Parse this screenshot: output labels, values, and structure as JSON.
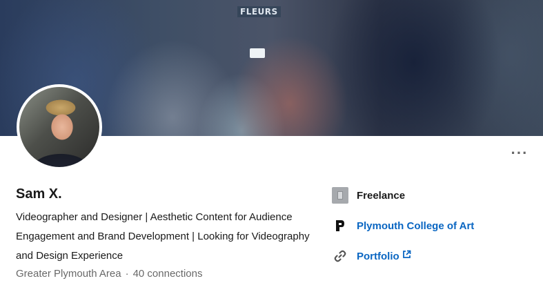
{
  "cover": {
    "sign_text": "FLEURS"
  },
  "profile": {
    "name": "Sam X.",
    "headline": "Videographer and Designer | Aesthetic Content for Audience Engagement and Brand Development | Looking for Videography and Design Experience",
    "location": "Greater Plymouth Area",
    "separator": "·",
    "connections": "40 connections"
  },
  "actions": {
    "more_label": "···"
  },
  "links": {
    "company": "Freelance",
    "school": "Plymouth College of Art",
    "website": "Portfolio"
  },
  "icons": {
    "more": "more-horizontal-icon",
    "company": "company-logo-icon",
    "school": "school-logo-icon",
    "link": "link-chain-icon",
    "external": "external-link-icon"
  },
  "colors": {
    "link_blue": "#0a66c2",
    "muted_text": "#666666"
  }
}
